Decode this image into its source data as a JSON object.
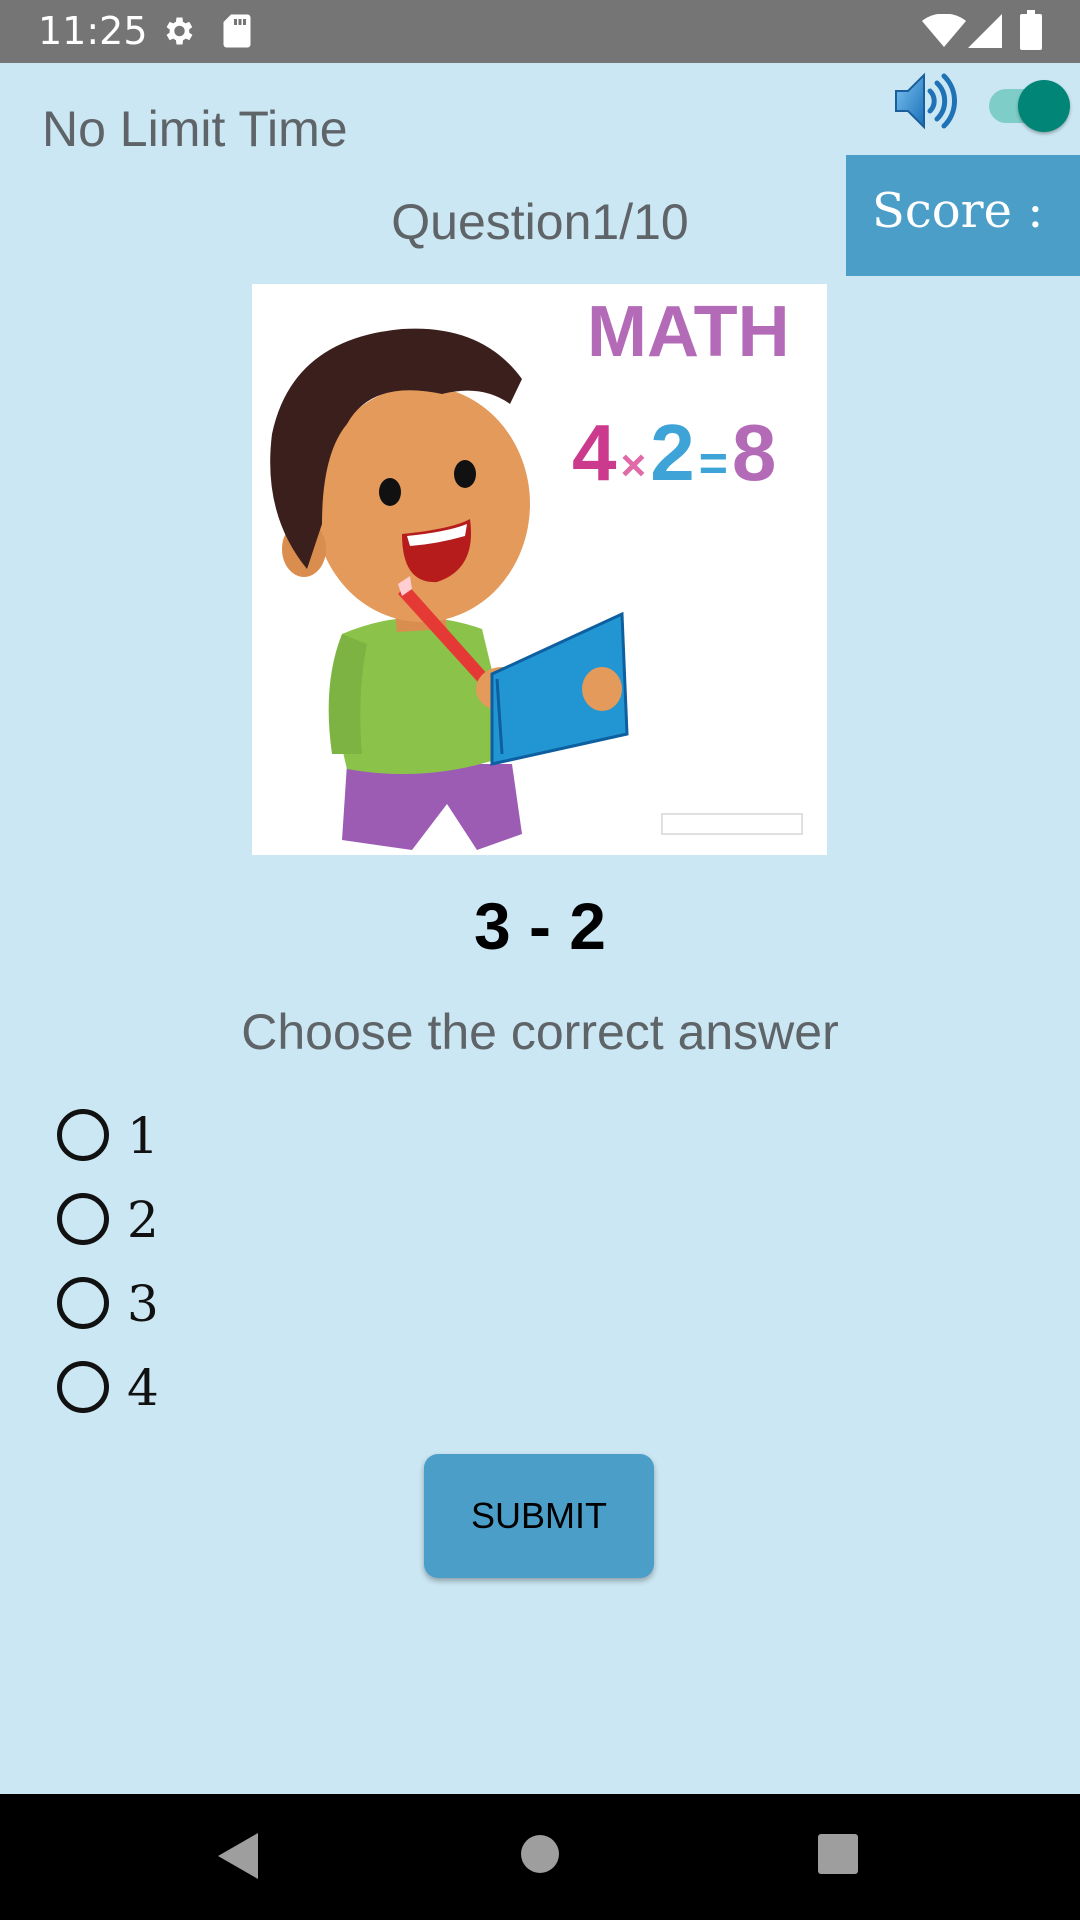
{
  "status_bar": {
    "time": "11:25",
    "icons": [
      "settings-icon",
      "sd-card-icon",
      "wifi-icon",
      "signal-icon",
      "battery-icon"
    ],
    "color": "#757575"
  },
  "header": {
    "timer_label": "No Limit Time",
    "sound_icon": "speaker-icon",
    "sound_toggle_on": true,
    "score_label": "Score :"
  },
  "question": {
    "counter": "Question1/10",
    "image": {
      "heading": "MATH",
      "equation_parts": [
        "4",
        "×",
        "2",
        "=",
        "8"
      ]
    },
    "problem": "3 - 2",
    "instruction": "Choose the correct answer",
    "options": [
      {
        "label": "1"
      },
      {
        "label": "2"
      },
      {
        "label": "3"
      },
      {
        "label": "4"
      }
    ]
  },
  "submit_label": "SUBMIT",
  "nav": {
    "back": "back-icon",
    "home": "home-icon",
    "recents": "recents-icon"
  },
  "colors": {
    "background": "#cbe7f3",
    "accent": "#4a9ec8",
    "toggle_on": "#008577"
  }
}
